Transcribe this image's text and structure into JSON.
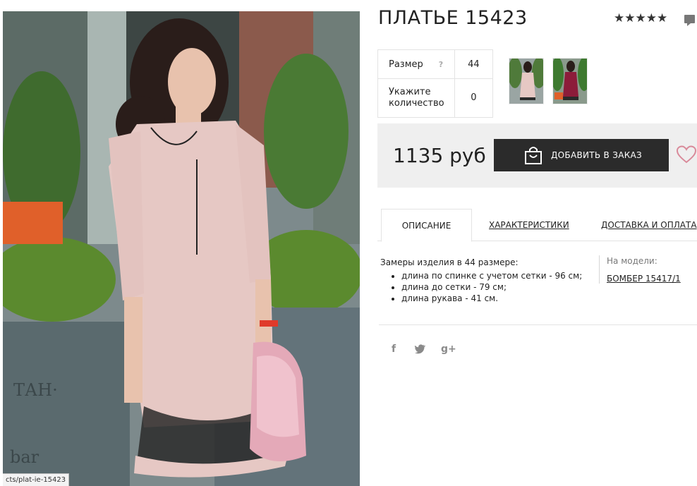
{
  "product": {
    "title": "ПЛАТЬЕ 15423",
    "rating_stars": "★★★★★"
  },
  "options": {
    "size_label": "Размер",
    "size_help": "?",
    "size_value": "44",
    "quantity_label": "Укажите количество",
    "quantity_value": "0"
  },
  "purchase": {
    "price": "1135 руб",
    "add_button_label": "ДОБАВИТЬ В ЗАКАЗ"
  },
  "tabs": [
    {
      "label": "ОПИСАНИЕ"
    },
    {
      "label": "ХАРАКТЕРИСТИКИ"
    },
    {
      "label": "ДОСТАВКА И ОПЛАТА"
    }
  ],
  "description": {
    "intro": "Замеры изделия в 44 размере:",
    "items": [
      "длина по спинке с учетом сетки - 96 см;",
      "длина до сетки - 79 см;",
      "длина рукава - 41 см."
    ],
    "model_label": "На модели:",
    "model_link": "БОМБЕР 15417/1"
  },
  "social": {
    "facebook": "f",
    "twitter": "t",
    "googleplus": "g+"
  },
  "status_bar": {
    "url": "cts/plat-ie-15423"
  },
  "colors": {
    "button_bg": "#2b2b2b",
    "price_bg": "#efefef",
    "heart": "#d98a9a"
  }
}
